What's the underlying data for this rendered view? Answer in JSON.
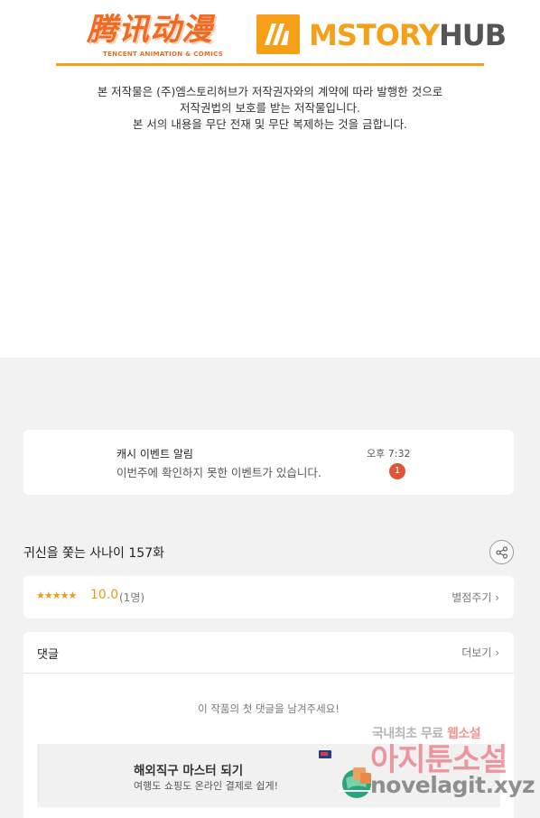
{
  "header": {
    "logo_left_main": "腾讯动漫",
    "logo_left_sub": "TENCENT ANIMATION & COMICS",
    "logo_right_part1": "MSTORY",
    "logo_right_part2": "HUB",
    "brand_colors": {
      "orange": "#f6a01a",
      "tencent_orange": "#f26a22"
    }
  },
  "copyright": {
    "line1": "본 저작물은 (주)엠스토리허브가 저작권자와의 계약에 따라 발행한 것으로",
    "line2": "저작권법의 보호를 받는 저작물입니다.",
    "line3": "본 서의 내용을 무단 전재 및 무단 복제하는 것을 금합니다."
  },
  "notice": {
    "title": "캐시 이벤트 알림",
    "time": "오후 7:32",
    "body": "이번주에 확인하지 못한 이벤트가 있습니다.",
    "badge_count": "1"
  },
  "episode": {
    "title": "귀신을 쫓는 사나이 157화",
    "share_icon": "share-icon"
  },
  "rating": {
    "stars_text": "★★★★★",
    "stars_value": 5,
    "score": "10.0",
    "count": "(1명)",
    "rate_link": "별점주기 ›"
  },
  "comments": {
    "title": "댓글",
    "more_link": "더보기 ›",
    "empty_text": "이 작품의 첫 댓글을 남겨주세요!"
  },
  "ad": {
    "title": "해외직구 마스터 되기",
    "subtitle": "여행도 쇼핑도 온라인 결제로 쉽게!"
  },
  "watermark": {
    "line1a": "국내최초 무료 ",
    "line1b": "웹소설",
    "line2": "아지툰소설",
    "line3": "novelagit.xyz"
  }
}
